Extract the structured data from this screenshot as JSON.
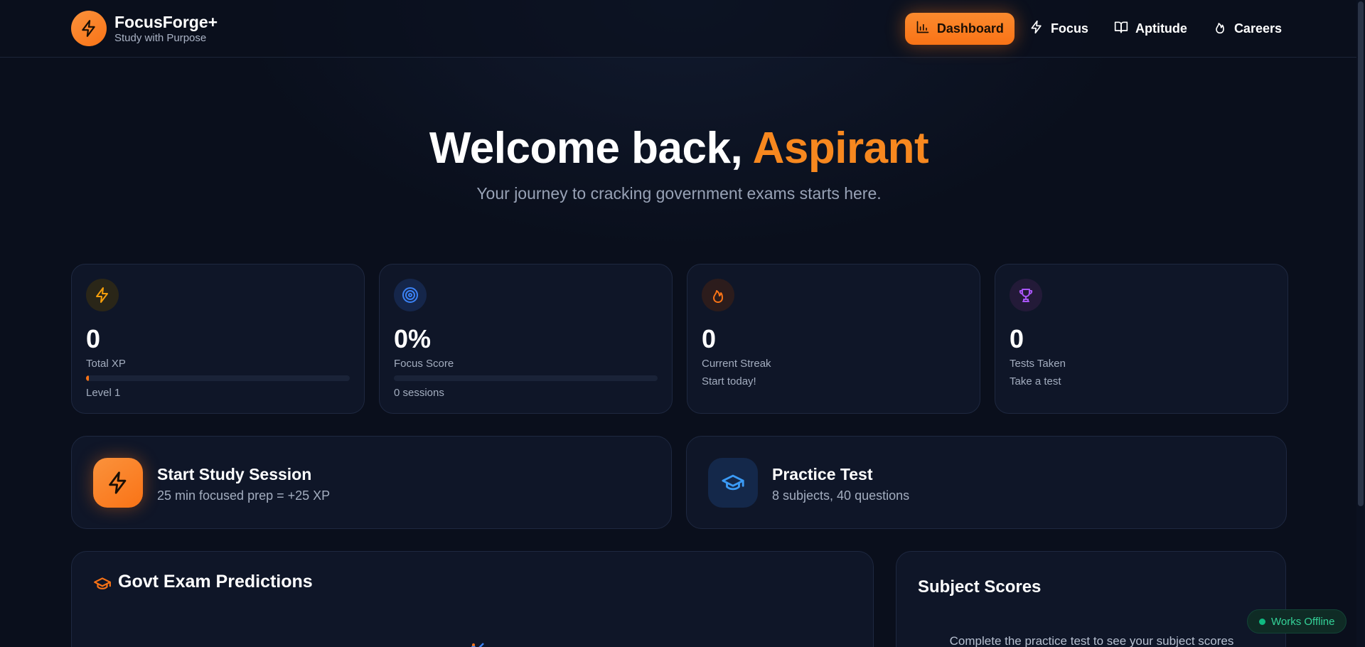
{
  "brand": {
    "name": "FocusForge+",
    "tagline": "Study with Purpose",
    "logo_icon": "zap-icon"
  },
  "nav": {
    "items": [
      {
        "label": "Dashboard",
        "icon": "bar-chart-icon",
        "active": true
      },
      {
        "label": "Focus",
        "icon": "zap-icon",
        "active": false
      },
      {
        "label": "Aptitude",
        "icon": "book-open-icon",
        "active": false
      },
      {
        "label": "Careers",
        "icon": "flame-icon",
        "active": false
      }
    ]
  },
  "hero": {
    "title_prefix": "Welcome back, ",
    "title_name": "Aspirant",
    "subtitle": "Your journey to cracking government exams starts here."
  },
  "stats": [
    {
      "icon": "zap-icon",
      "value": "0",
      "label": "Total XP",
      "progress": 0.01,
      "footer": "Level 1",
      "accent": "#f59e0b"
    },
    {
      "icon": "target-icon",
      "value": "0%",
      "label": "Focus Score",
      "progress": 0,
      "footer": "0 sessions",
      "accent": "#3b82f6"
    },
    {
      "icon": "flame-icon",
      "value": "0",
      "label": "Current Streak",
      "footer": "Start today!",
      "accent": "#f97316"
    },
    {
      "icon": "trophy-icon",
      "value": "0",
      "label": "Tests Taken",
      "footer": "Take a test",
      "accent": "#a855f7"
    }
  ],
  "actions": [
    {
      "icon": "zap-icon",
      "title": "Start Study Session",
      "subtitle": "25 min focused prep = +25 XP"
    },
    {
      "icon": "graduation-cap-icon",
      "title": "Practice Test",
      "subtitle": "8 subjects, 40 questions"
    }
  ],
  "panels": {
    "predictions": {
      "title": "Govt Exam Predictions",
      "icon": "graduation-cap-icon"
    },
    "subject_scores": {
      "title": "Subject Scores",
      "message": "Complete the practice test to see your subject scores"
    }
  },
  "offline_badge": "Works Offline",
  "colors": {
    "accent": "#f97316",
    "background": "#0a0f1c",
    "card": "#0f1628",
    "success": "#10b981"
  }
}
